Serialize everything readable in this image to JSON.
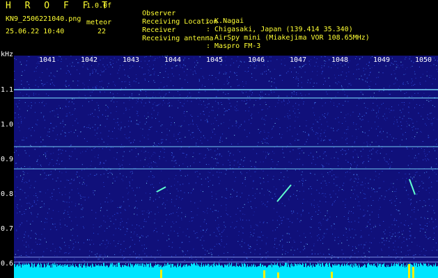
{
  "header": {
    "logo": "H R O F F T",
    "version": "1.0.0f",
    "filename": "KN9_2506221040.png",
    "meteor_label": "meteor",
    "datetime": "25.06.22 10:40",
    "meteor_count": "22",
    "info": [
      {
        "label": "Observer",
        "value": ": K.Nagai"
      },
      {
        "label": "Receiving Location",
        "value": ": Chigasaki, Japan (139.414 35.340)"
      },
      {
        "label": "Receiver",
        "value": ": AirSpy mini (Miakejima VOR 108.65MHz)"
      },
      {
        "label": "Receiving antenna",
        "value": ": Maspro FM-3"
      }
    ]
  },
  "axis": {
    "y_unit": "kHz",
    "y_ticks": [
      "1.1",
      "1.0",
      "0.9",
      "0.8",
      "0.7",
      "0.6"
    ],
    "x_ticks": [
      "1041",
      "1042",
      "1043",
      "1044",
      "1045",
      "1046",
      "1047",
      "1048",
      "1049",
      "1050"
    ]
  },
  "colors": {
    "text": "#ffff33",
    "background": "#10107a",
    "signal": "#7fe0ff",
    "bottom_band": "#00e5ff",
    "spike": "#ffee00"
  }
}
